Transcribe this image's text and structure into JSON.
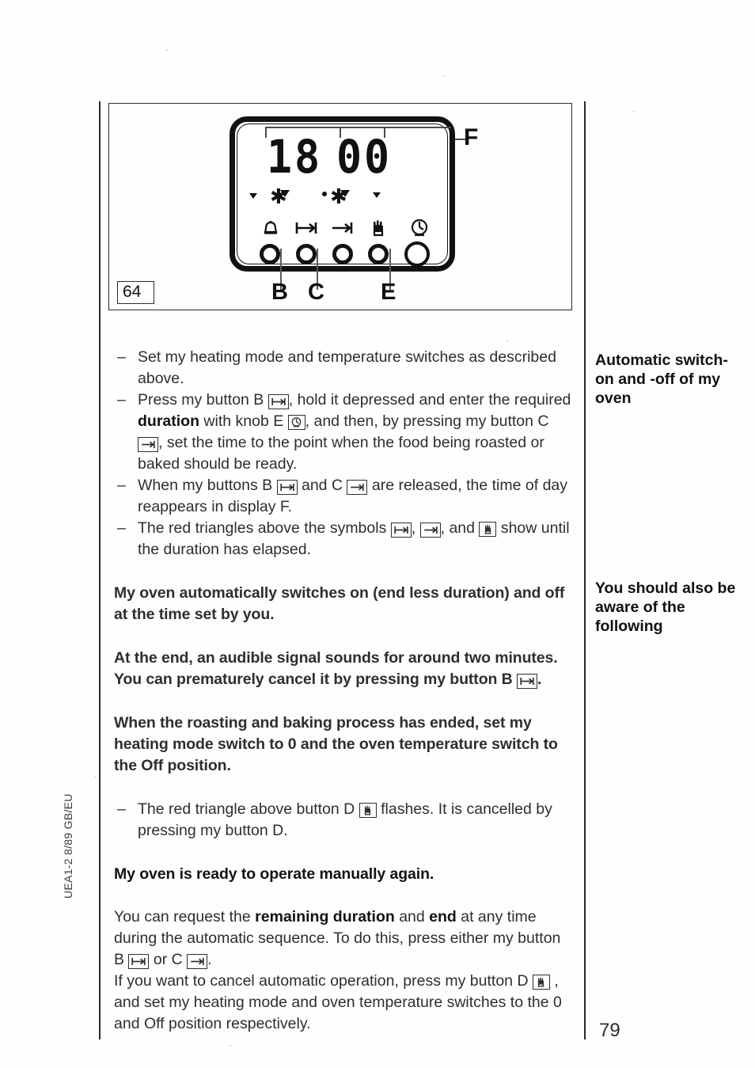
{
  "page": {
    "number": "79",
    "side_code": "UEA1-2 8/89  GB/EU"
  },
  "figure": {
    "number": "64",
    "display_value": "18.00",
    "display_digits": [
      "1",
      "8",
      "0",
      "0"
    ],
    "callout_display": "F",
    "callout_buttons": [
      "B",
      "C",
      "E"
    ],
    "symbols": [
      {
        "name": "bell-icon",
        "glyph": "bell"
      },
      {
        "name": "duration-icon",
        "glyph": "|->|"
      },
      {
        "name": "end-time-icon",
        "glyph": "->|"
      },
      {
        "name": "hand-icon",
        "glyph": "hand"
      },
      {
        "name": "clock-knob-icon",
        "glyph": "clock"
      }
    ]
  },
  "body": {
    "bullets": [
      {
        "dash": "–",
        "parts": [
          {
            "t": "text",
            "v": "Set my heating mode and temperature switches as described above."
          }
        ]
      },
      {
        "dash": "–",
        "parts": [
          {
            "t": "text",
            "v": "Press my button B "
          },
          {
            "t": "icon",
            "v": "duration-icon"
          },
          {
            "t": "text",
            "v": ", hold it depressed and enter the required "
          },
          {
            "t": "bold",
            "v": "duration"
          },
          {
            "t": "text",
            "v": " with knob E "
          },
          {
            "t": "icon",
            "v": "clock-knob-icon"
          },
          {
            "t": "text",
            "v": ", and then, by pressing my button C "
          },
          {
            "t": "icon",
            "v": "end-time-icon"
          },
          {
            "t": "text",
            "v": ", set the time to the point when the food being roasted or baked should be ready."
          }
        ]
      },
      {
        "dash": "–",
        "parts": [
          {
            "t": "text",
            "v": "When my buttons B "
          },
          {
            "t": "icon",
            "v": "duration-icon"
          },
          {
            "t": "text",
            "v": " and C "
          },
          {
            "t": "icon",
            "v": "end-time-icon"
          },
          {
            "t": "text",
            "v": " are released, the time of day reappears in display F."
          }
        ]
      },
      {
        "dash": "–",
        "parts": [
          {
            "t": "text",
            "v": "The red triangles above the symbols "
          },
          {
            "t": "icon",
            "v": "duration-icon"
          },
          {
            "t": "text",
            "v": ", "
          },
          {
            "t": "icon",
            "v": "end-time-icon"
          },
          {
            "t": "text",
            "v": ", and "
          },
          {
            "t": "icon",
            "v": "hand-icon"
          },
          {
            "t": "text",
            "v": " show until the duration has elapsed."
          }
        ]
      }
    ],
    "bold_blocks": [
      {
        "parts": [
          {
            "t": "text",
            "v": "My oven automatically switches on (end less duration) and off at the time set by you."
          }
        ]
      },
      {
        "parts": [
          {
            "t": "text",
            "v": "At the end, an audible signal sounds for around two minutes. You can prematurely cancel it by pressing my button B "
          },
          {
            "t": "icon",
            "v": "duration-icon"
          },
          {
            "t": "text",
            "v": "."
          }
        ]
      },
      {
        "parts": [
          {
            "t": "text",
            "v": "When the roasting and baking process has ended, set my heating mode switch to 0 and the oven temperature switch to the Off position."
          }
        ]
      }
    ],
    "bullet_d": {
      "dash": "–",
      "parts": [
        {
          "t": "text",
          "v": "The red triangle above button D "
        },
        {
          "t": "icon",
          "v": "hand-icon"
        },
        {
          "t": "text",
          "v": " flashes. It is cancelled by pressing my button D."
        }
      ]
    },
    "ready_line": {
      "parts": [
        {
          "t": "text",
          "v": "My oven is ready to operate manually again."
        }
      ]
    },
    "closing": [
      {
        "parts": [
          {
            "t": "text",
            "v": "You can request the "
          },
          {
            "t": "bold",
            "v": "remaining duration"
          },
          {
            "t": "text",
            "v": " and "
          },
          {
            "t": "bold",
            "v": "end"
          },
          {
            "t": "text",
            "v": " at any time during the automatic sequence. To do this, press either my button B "
          },
          {
            "t": "icon",
            "v": "duration-icon"
          },
          {
            "t": "text",
            "v": " or C "
          },
          {
            "t": "icon",
            "v": "end-time-icon"
          },
          {
            "t": "text",
            "v": "."
          }
        ]
      },
      {
        "parts": [
          {
            "t": "text",
            "v": "If you want to cancel automatic operation, press my button D "
          },
          {
            "t": "icon",
            "v": "hand-icon"
          },
          {
            "t": "text",
            "v": " , and set my heating mode and oven temperature switches to the 0 and Off position respectively."
          }
        ]
      }
    ]
  },
  "margin_notes": [
    {
      "name": "automatic-switch-note",
      "text": "Automatic switch-on and -off of my oven"
    },
    {
      "name": "awareness-note",
      "text": "You should also be aware of the following"
    }
  ]
}
